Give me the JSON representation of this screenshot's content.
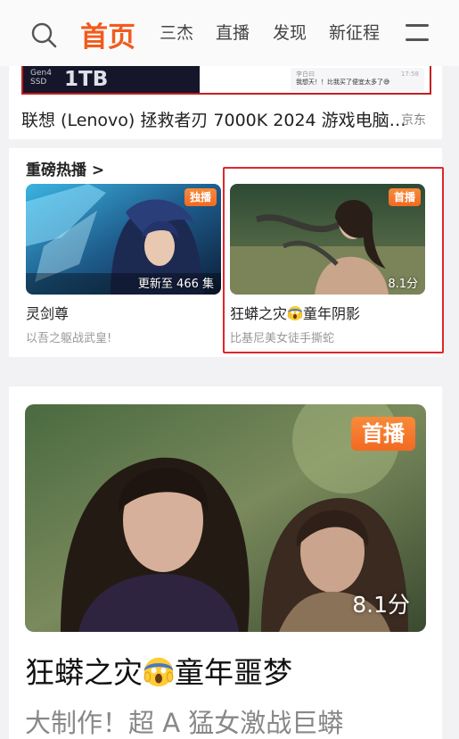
{
  "nav": {
    "tabs": [
      "首页",
      "三杰",
      "直播",
      "发现",
      "新征程"
    ],
    "active_index": 0,
    "accent": "#f25a1c",
    "search_icon": "search-icon",
    "menu_icon": "menu-icon"
  },
  "ad": {
    "ssd_small_line1": "Gen4",
    "ssd_small_line2": "SSD",
    "ssd_capacity": "1TB",
    "chat_name": "李白曰",
    "chat_text": "我想天！！比我买了便宜太多了😅",
    "chat_time": "17:58",
    "title": "联想 (Lenovo) 拯救者刃 7000K 2024 游戏电脑…",
    "source": "京东"
  },
  "hot": {
    "title": "重磅热播 >",
    "cards": [
      {
        "badge": "独播",
        "overlay": "更新至 466 集",
        "title": "灵剑尊",
        "subtitle": "以吾之躯战武皇!"
      },
      {
        "badge": "首播",
        "overlay": "8.1分",
        "title_pre": "狂蟒之灾",
        "title_post": "童年阴影",
        "subtitle": "比基尼美女徒手撕蛇"
      }
    ]
  },
  "feature": {
    "badge": "首播",
    "score": "8.1分",
    "title_pre": "狂蟒之灾",
    "title_post": "童年噩梦",
    "subtitle": "大制作！超 A 猛女激战巨蟒"
  },
  "colors": {
    "badge": "#f26a22",
    "highlight": "#e0262b"
  }
}
